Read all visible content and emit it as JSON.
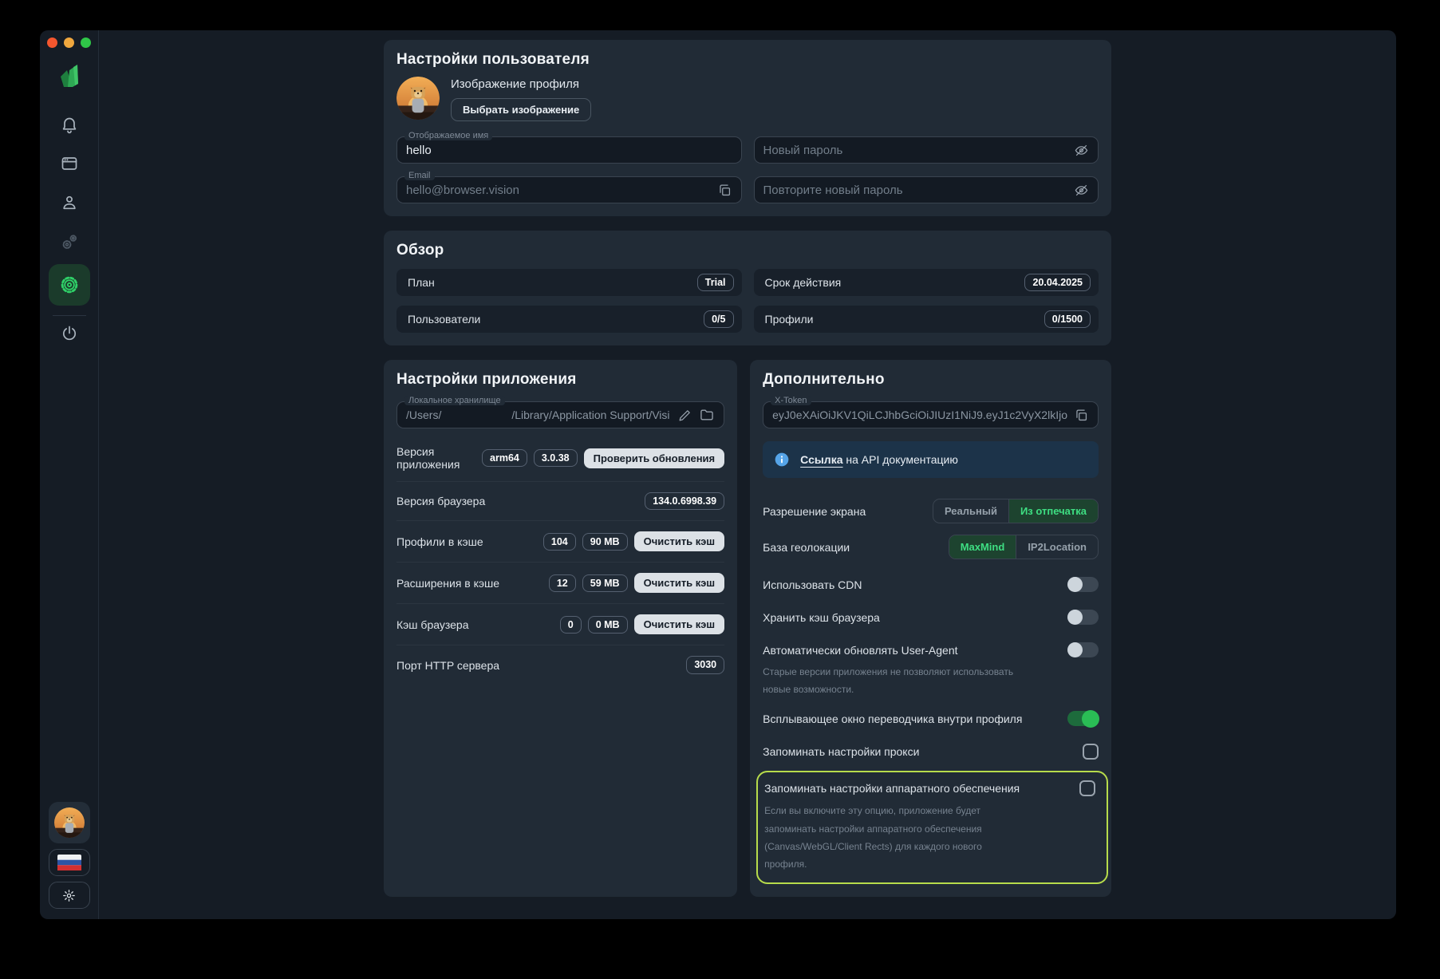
{
  "window_controls": {
    "close_color": "#f4562e",
    "minimize_color": "#f0a73e",
    "zoom_color": "#2fc648"
  },
  "sidebar": {
    "icons": [
      "app-logo",
      "bell",
      "browser-window",
      "profile",
      "automation-gears",
      "settings-gear",
      "power",
      "user-avatar",
      "language-flag-ru",
      "theme-sun"
    ]
  },
  "user_settings": {
    "title": "Настройки пользователя",
    "profile_image_label": "Изображение профиля",
    "choose_image_button": "Выбрать изображение",
    "display_name": {
      "label": "Отображаемое имя",
      "value": "hello"
    },
    "email": {
      "label": "Email",
      "placeholder": "hello@browser.vision"
    },
    "new_password_placeholder": "Новый пароль",
    "repeat_password_placeholder": "Повторите новый пароль"
  },
  "overview": {
    "title": "Обзор",
    "items": [
      {
        "label": "План",
        "value": "Trial"
      },
      {
        "label": "Срок действия",
        "value": "20.04.2025"
      },
      {
        "label": "Пользователи",
        "value": "0/5"
      },
      {
        "label": "Профили",
        "value": "0/1500"
      }
    ]
  },
  "app_settings": {
    "title": "Настройки приложения",
    "local_storage": {
      "label": "Локальное хранилище",
      "path_prefix": "/Users/",
      "path_suffix": "/Library/Application Support/Visi"
    },
    "rows": [
      {
        "label": "Версия приложения",
        "badges": [
          "arm64",
          "3.0.38"
        ],
        "button": "Проверить обновления"
      },
      {
        "label": "Версия браузера",
        "badges": [
          "134.0.6998.39"
        ]
      },
      {
        "label": "Профили в кэше",
        "badges": [
          "104",
          "90 MB"
        ],
        "button": "Очистить кэш"
      },
      {
        "label": "Расширения в кэше",
        "badges": [
          "12",
          "59 MB"
        ],
        "button": "Очистить кэш"
      },
      {
        "label": "Кэш браузера",
        "badges": [
          "0",
          "0 MB"
        ],
        "button": "Очистить кэш"
      },
      {
        "label": "Порт HTTP сервера",
        "badges": [
          "3030"
        ]
      }
    ]
  },
  "advanced": {
    "title": "Дополнительно",
    "x_token": {
      "label": "X-Token",
      "value": "eyJ0eXAiOiJKV1QiLCJhbGciOiJIUzI1NiJ9.eyJ1c2VyX2lkIjo"
    },
    "api_banner": {
      "link_text": "Ссылка",
      "rest_text": "на API документацию"
    },
    "screen_resolution": {
      "label": "Разрешение экрана",
      "options": [
        "Реальный",
        "Из отпечатка"
      ],
      "selected": "Из отпечатка"
    },
    "geo_db": {
      "label": "База геолокации",
      "options": [
        "MaxMind",
        "IP2Location"
      ],
      "selected": "MaxMind"
    },
    "toggles": [
      {
        "label": "Использовать CDN",
        "on": false
      },
      {
        "label": "Хранить кэш браузера",
        "on": false
      },
      {
        "label": "Автоматически обновлять User-Agent",
        "on": false,
        "description": "Старые версии приложения не позволяют использовать новые возможности."
      },
      {
        "label": "Всплывающее окно переводчика внутри профиля",
        "on": true
      }
    ],
    "checkboxes": [
      {
        "label": "Запоминать настройки прокси",
        "checked": false
      },
      {
        "label": "Запоминать настройки аппаратного обеспечения",
        "checked": false,
        "highlighted": true,
        "description": "Если вы включите эту опцию, приложение будет запоминать настройки аппаратного обеспечения (Canvas/WebGL/Client Rects) для каждого нового профиля."
      }
    ]
  }
}
